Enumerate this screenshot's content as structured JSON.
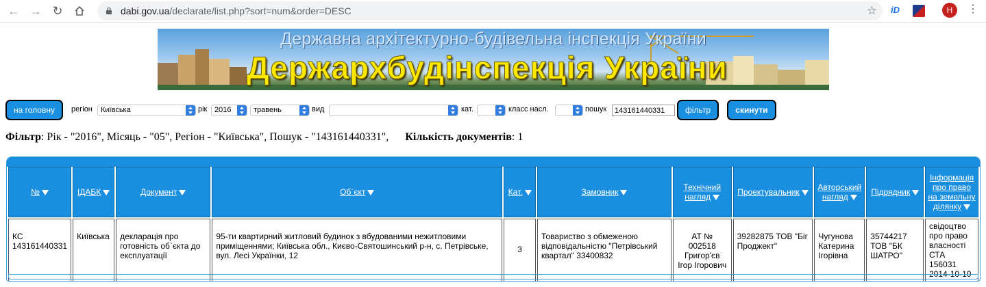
{
  "browser": {
    "url_host": "dabi.gov.ua",
    "url_path": "/declarate/list.php?sort=num&order=DESC",
    "avatar_letter": "H"
  },
  "banner": {
    "top_title": "Державна архітектурно-будівельна інспекція України",
    "main_title": "Держархбудінспекція України"
  },
  "filter": {
    "home_label": "на головну",
    "region_label": "регіон",
    "region_value": "Київська",
    "year_label": "рік",
    "year_value": "2016",
    "month_value": "травень",
    "type_label": "вид",
    "type_value": "",
    "category_label": "кат.",
    "category_value": "",
    "class_label": "класс насл.",
    "class_value": "",
    "search_label": "пошук",
    "search_value": "143161440331",
    "filter_button": "фільтр",
    "reset_button": "скинути"
  },
  "summary": {
    "filter_label": "Фільтр",
    "filter_text": ": Рік - \"2016\", Місяць - \"05\", Регіон - \"Київська\", Пошук - \"143161440331\",",
    "count_label": "Кількість документів",
    "count_value": ": 1"
  },
  "table": {
    "headers": [
      "№",
      "ІДАБК",
      "Документ",
      "Об`єкт",
      "Кат.",
      "Замовник",
      "Технічний нагляд",
      "Проектувальник",
      "Авторський нагляд",
      "Підрядник",
      "Інформація про право на земельну ділянку"
    ],
    "rows": [
      {
        "num": "КС 143161440331",
        "idabk": "Київська",
        "document": "декларація про готовність об`єкта до експлуатації",
        "object": "95-ти квартирний житловий будинок з вбудованими нежитловими приміщеннями; Київська обл., Києво-Святошинський р-н, с. Петрівське, вул. Лесі Українки, 12",
        "category": "3",
        "customer": "Товариство з обмеженою відповідальністю \"Петрівський квартал\" 33400832",
        "tech_supervision": "АТ № 002518 Григор'єв Ігор Ігорович",
        "designer": "39282875 ТОВ \"Біг Проджект\"",
        "author_supervision": "Чугунова Катерина Ігорівна",
        "contractor": "35744217 ТОВ \"БК ШАТРО\"",
        "land_info": "свідоцтво про право власності СТА 156031 2014-10-10"
      }
    ]
  }
}
